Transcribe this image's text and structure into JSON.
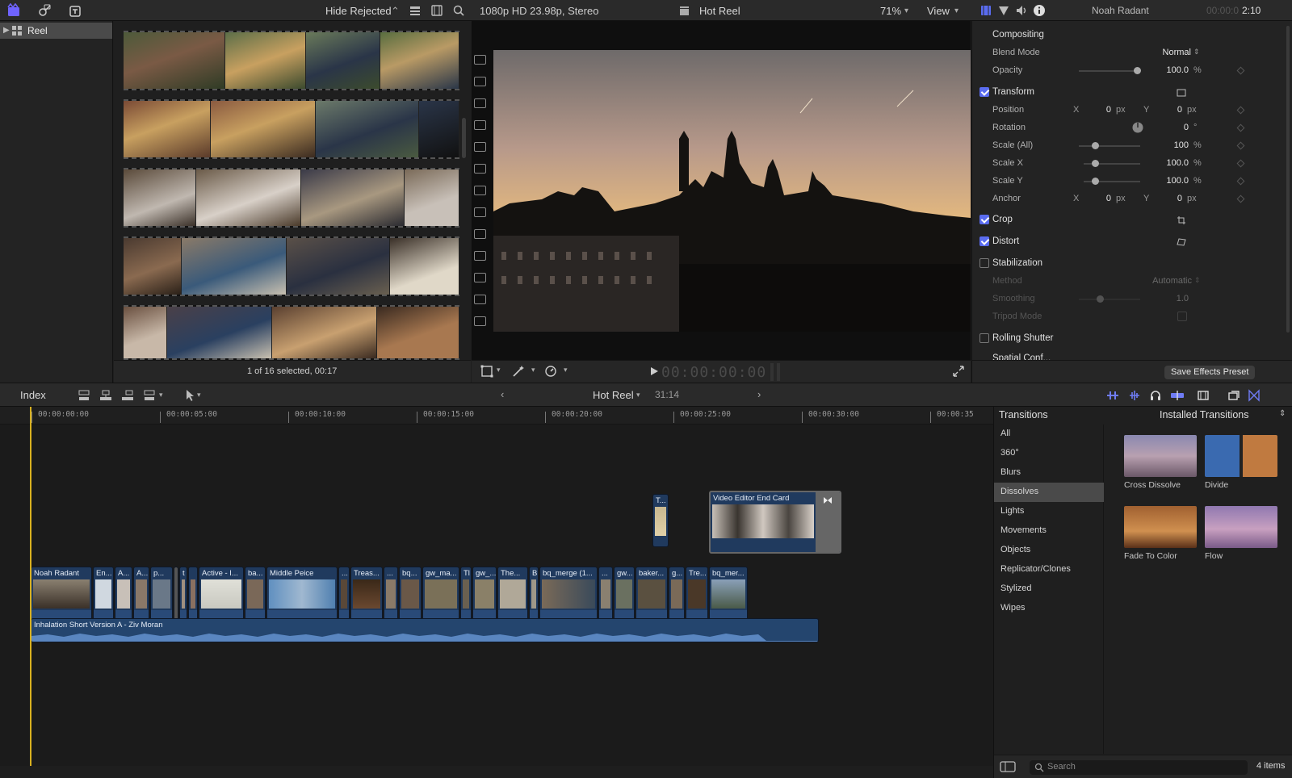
{
  "top_bar": {
    "hide_rejected": "Hide Rejected",
    "format": "1080p HD 23.98p, Stereo",
    "project_title": "Hot Reel",
    "zoom": "71%",
    "view_menu": "View",
    "inspector_clip": "Noah Radant",
    "inspector_tc_dim": "00:00:0",
    "inspector_tc": "2:10"
  },
  "library": {
    "item": "Reel"
  },
  "browser": {
    "status": "1 of 16 selected, 00:17"
  },
  "viewer": {
    "timecode": "00:00:00:00"
  },
  "inspector": {
    "compositing": "Compositing",
    "blend_mode_label": "Blend Mode",
    "blend_mode_value": "Normal",
    "opacity_label": "Opacity",
    "opacity_value": "100.0",
    "transform": "Transform",
    "position_label": "Position",
    "position_x": "0",
    "position_y": "0",
    "rotation_label": "Rotation",
    "rotation_value": "0",
    "scale_all_label": "Scale (All)",
    "scale_all_value": "100",
    "scale_x_label": "Scale X",
    "scale_x_value": "100.0",
    "scale_y_label": "Scale Y",
    "scale_y_value": "100.0",
    "anchor_label": "Anchor",
    "anchor_x": "0",
    "anchor_y": "0",
    "crop": "Crop",
    "distort": "Distort",
    "stabilization": "Stabilization",
    "method_label": "Method",
    "method_value": "Automatic",
    "smoothing_label": "Smoothing",
    "smoothing_value": "1.0",
    "tripod_label": "Tripod Mode",
    "rolling_shutter": "Rolling Shutter",
    "partial_next": "Spatial Conf...",
    "units": {
      "percent": "%",
      "px": "px",
      "degree": "°",
      "x": "X",
      "y": "Y"
    },
    "save_preset": "Save Effects Preset"
  },
  "timeline_toolbar": {
    "index": "Index",
    "project": "Hot Reel",
    "duration": "31:14"
  },
  "timeline": {
    "ruler": [
      "00:00:00:00",
      "00:00:05:00",
      "00:00:10:00",
      "00:00:15:00",
      "00:00:20:00",
      "00:00:25:00",
      "00:00:30:00",
      "00:00:35"
    ],
    "clips": [
      "Noah Radant",
      "En...",
      "A...",
      "A...",
      "p...",
      "t",
      "Active - I...",
      "ba...",
      "Middle Peice",
      "...",
      "Treas...",
      "...",
      "bq...",
      "gw_ma...",
      "Tl",
      "gw_...",
      "The...",
      "Bi",
      "bq_merge (1...",
      "...",
      "gw...",
      "baker...",
      "g...",
      "Tre...",
      "bq_mer..."
    ],
    "connected_clip_small": "T...",
    "end_card": "Video Editor End Card",
    "audio_clip": "Inhalation   Short Version A - Ziv Moran"
  },
  "transitions": {
    "header": "Transitions",
    "source": "Installed Transitions",
    "categories": [
      "All",
      "360°",
      "Blurs",
      "Dissolves",
      "Lights",
      "Movements",
      "Objects",
      "Replicator/Clones",
      "Stylized",
      "Wipes"
    ],
    "selected_category": "Dissolves",
    "items": [
      "Cross Dissolve",
      "Divide",
      "Fade To Color",
      "Flow"
    ],
    "search_placeholder": "Search",
    "count": "4 items"
  },
  "colors": {
    "accent": "#5a6cf0",
    "playhead": "#d8b020",
    "clip": "#203a5e"
  }
}
